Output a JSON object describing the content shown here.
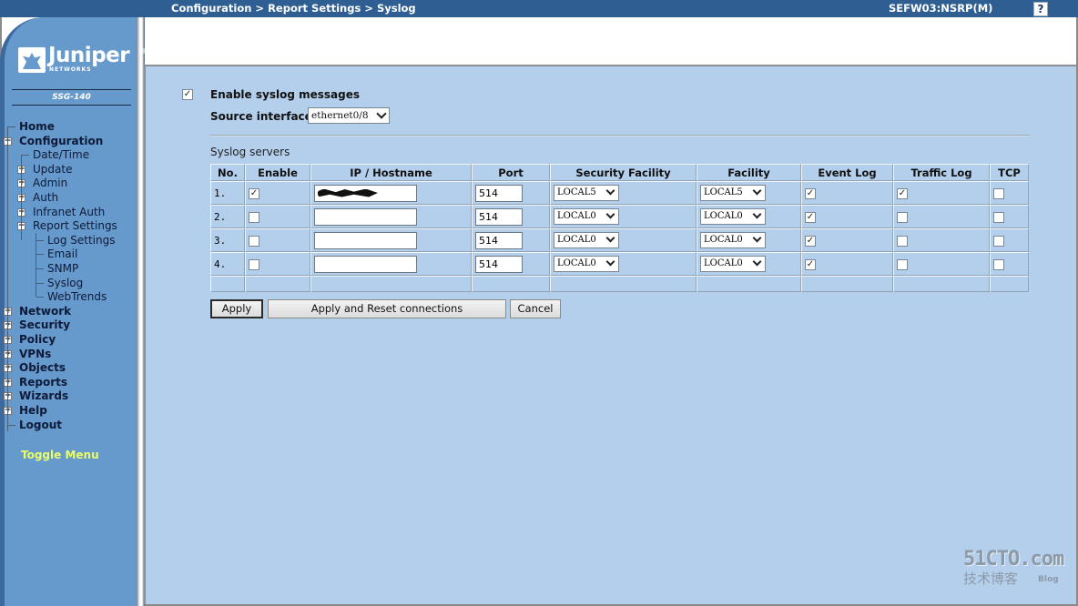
{
  "header": {
    "breadcrumb": "Configuration > Report Settings > Syslog",
    "device": "SEFW03:NSRP(M)",
    "help_icon": "?"
  },
  "sidebar": {
    "logo_text": "Juniper",
    "logo_sub": "NETWORKS",
    "logo_reg": "®",
    "model": "SSG-140",
    "items": [
      {
        "label": "Home",
        "level": 0,
        "expander": ""
      },
      {
        "label": "Configuration",
        "level": 0,
        "expander": "−"
      },
      {
        "label": "Date/Time",
        "level": 1,
        "expander": ""
      },
      {
        "label": "Update",
        "level": 1,
        "expander": "+"
      },
      {
        "label": "Admin",
        "level": 1,
        "expander": "+"
      },
      {
        "label": "Auth",
        "level": 1,
        "expander": "+"
      },
      {
        "label": "Infranet Auth",
        "level": 1,
        "expander": "+"
      },
      {
        "label": "Report Settings",
        "level": 1,
        "expander": "−"
      },
      {
        "label": "Log Settings",
        "level": 2,
        "expander": ""
      },
      {
        "label": "Email",
        "level": 2,
        "expander": ""
      },
      {
        "label": "SNMP",
        "level": 2,
        "expander": ""
      },
      {
        "label": "Syslog",
        "level": 2,
        "expander": ""
      },
      {
        "label": "WebTrends",
        "level": 2,
        "expander": ""
      },
      {
        "label": "Network",
        "level": 0,
        "expander": "+"
      },
      {
        "label": "Security",
        "level": 0,
        "expander": "+"
      },
      {
        "label": "Policy",
        "level": 0,
        "expander": "+"
      },
      {
        "label": "VPNs",
        "level": 0,
        "expander": "+"
      },
      {
        "label": "Objects",
        "level": 0,
        "expander": "+"
      },
      {
        "label": "Reports",
        "level": 0,
        "expander": "+"
      },
      {
        "label": "Wizards",
        "level": 0,
        "expander": "+"
      },
      {
        "label": "Help",
        "level": 0,
        "expander": "+"
      },
      {
        "label": "Logout",
        "level": 0,
        "expander": ""
      }
    ],
    "toggle_menu": "Toggle Menu"
  },
  "form": {
    "enable_syslog": {
      "label": "Enable syslog messages",
      "checked": true
    },
    "source_interface": {
      "label": "Source interface",
      "value": "ethernet0/8"
    },
    "section_title": "Syslog servers",
    "columns": [
      "No.",
      "Enable",
      "IP / Hostname",
      "Port",
      "Security Facility",
      "Facility",
      "Event Log",
      "Traffic Log",
      "TCP"
    ],
    "rows": [
      {
        "no": "1.",
        "enable": true,
        "host": "[redacted]",
        "port": "514",
        "security_facility": "LOCAL5",
        "facility": "LOCAL5",
        "event_log": true,
        "traffic_log": true,
        "tcp": false
      },
      {
        "no": "2.",
        "enable": false,
        "host": "",
        "port": "514",
        "security_facility": "LOCAL0",
        "facility": "LOCAL0",
        "event_log": true,
        "traffic_log": false,
        "tcp": false
      },
      {
        "no": "3.",
        "enable": false,
        "host": "",
        "port": "514",
        "security_facility": "LOCAL0",
        "facility": "LOCAL0",
        "event_log": true,
        "traffic_log": false,
        "tcp": false
      },
      {
        "no": "4.",
        "enable": false,
        "host": "",
        "port": "514",
        "security_facility": "LOCAL0",
        "facility": "LOCAL0",
        "event_log": true,
        "traffic_log": false,
        "tcp": false
      }
    ],
    "buttons": {
      "apply": "Apply",
      "apply_reset": "Apply and Reset connections",
      "cancel": "Cancel"
    }
  },
  "watermark": {
    "line1": "51CTO.com",
    "line2": "技术博客",
    "line3": "Blog"
  },
  "colors": {
    "topbar": "#2f5f92",
    "sidebar": "#6699cc",
    "panel": "#b4cfec",
    "toggle_menu": "#eaff6a"
  }
}
